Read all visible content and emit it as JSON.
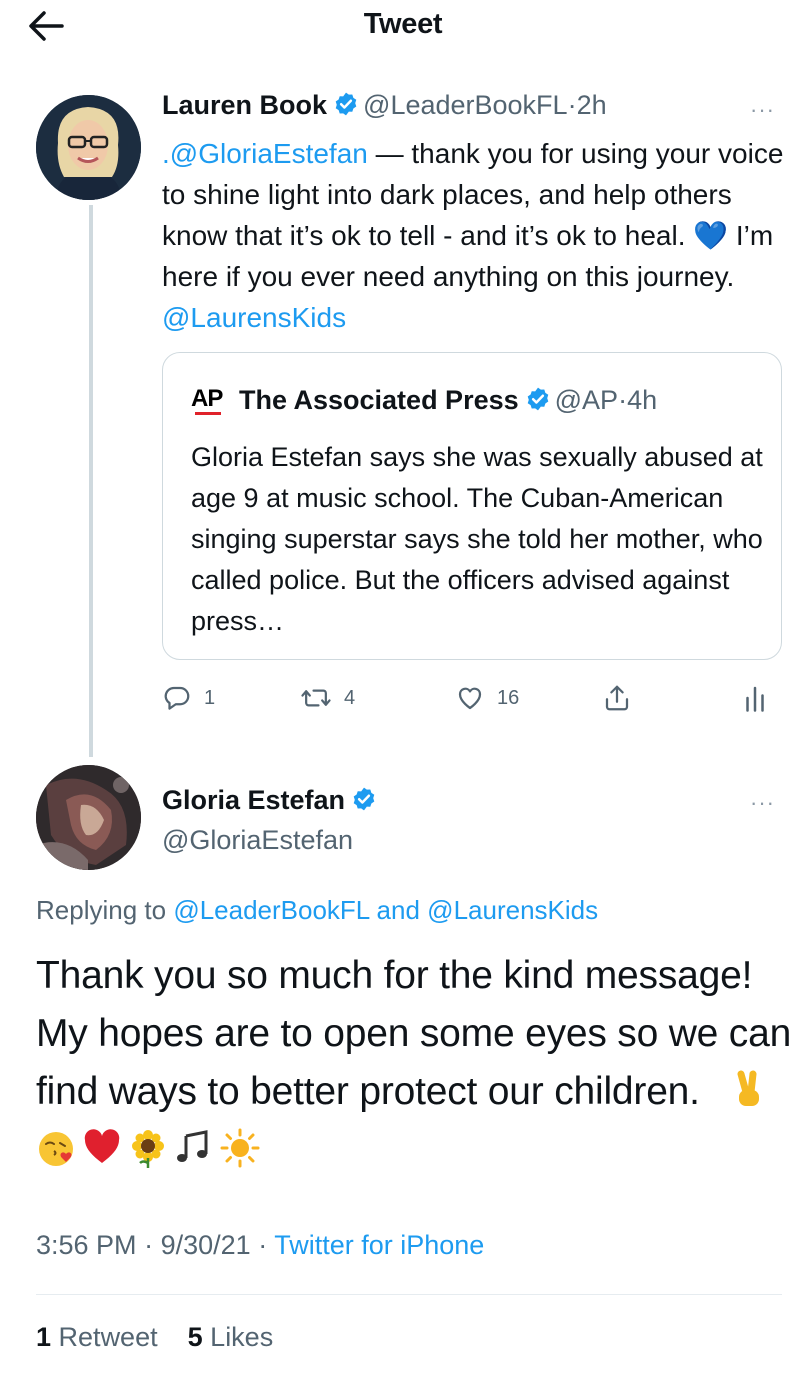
{
  "header": {
    "title": "Tweet"
  },
  "parent_tweet": {
    "author": "Lauren Book",
    "handle": "@LeaderBookFL",
    "separator": "·",
    "time": "2h",
    "more": "···",
    "text_parts": [
      {
        "text": ".@GloriaEstefan",
        "link": true
      },
      {
        "text": " — thank you for using your voice to shine light into dark places, and help others know that it’s ok to tell - and it’s ok to heal. 💙 I’m here if you ever need anything on this journey. ",
        "link": false
      },
      {
        "text": "@LaurensKids",
        "link": true
      }
    ],
    "quoted": {
      "logo": "AP",
      "author": "The Associated Press",
      "handle": "@AP",
      "separator": "·",
      "time": "4h",
      "text": "Gloria Estefan says she was sexually abused at age 9 at music school. The Cuban-American singing superstar says she told her mother, who called police. But the officers advised against press…"
    },
    "actions": {
      "replies": "1",
      "retweets": "4",
      "likes": "16"
    }
  },
  "main_tweet": {
    "author": "Gloria Estefan",
    "handle": "@GloriaEstefan",
    "more": "···",
    "replying_prefix": "Replying to",
    "replying_to_1": "@LeaderBookFL",
    "replying_and": "and",
    "replying_to_2": "@LaurensKids",
    "text": "Thank you so much for the kind message! My hopes are to open some eyes so we can find ways to better protect our children.",
    "emojis": [
      "victory-hand",
      "face-blowing-kiss",
      "red-heart",
      "sunflower",
      "musical-notes",
      "sun"
    ],
    "time": "3:56 PM",
    "date": "9/30/21",
    "separator": "·",
    "source": "Twitter for iPhone",
    "retweet_count": "1",
    "retweet_label": "Retweet",
    "like_count": "5",
    "like_label": "Likes"
  },
  "colors": {
    "accent": "#1d9bf0",
    "secondary_text": "#536471",
    "border": "#cfd9de"
  }
}
